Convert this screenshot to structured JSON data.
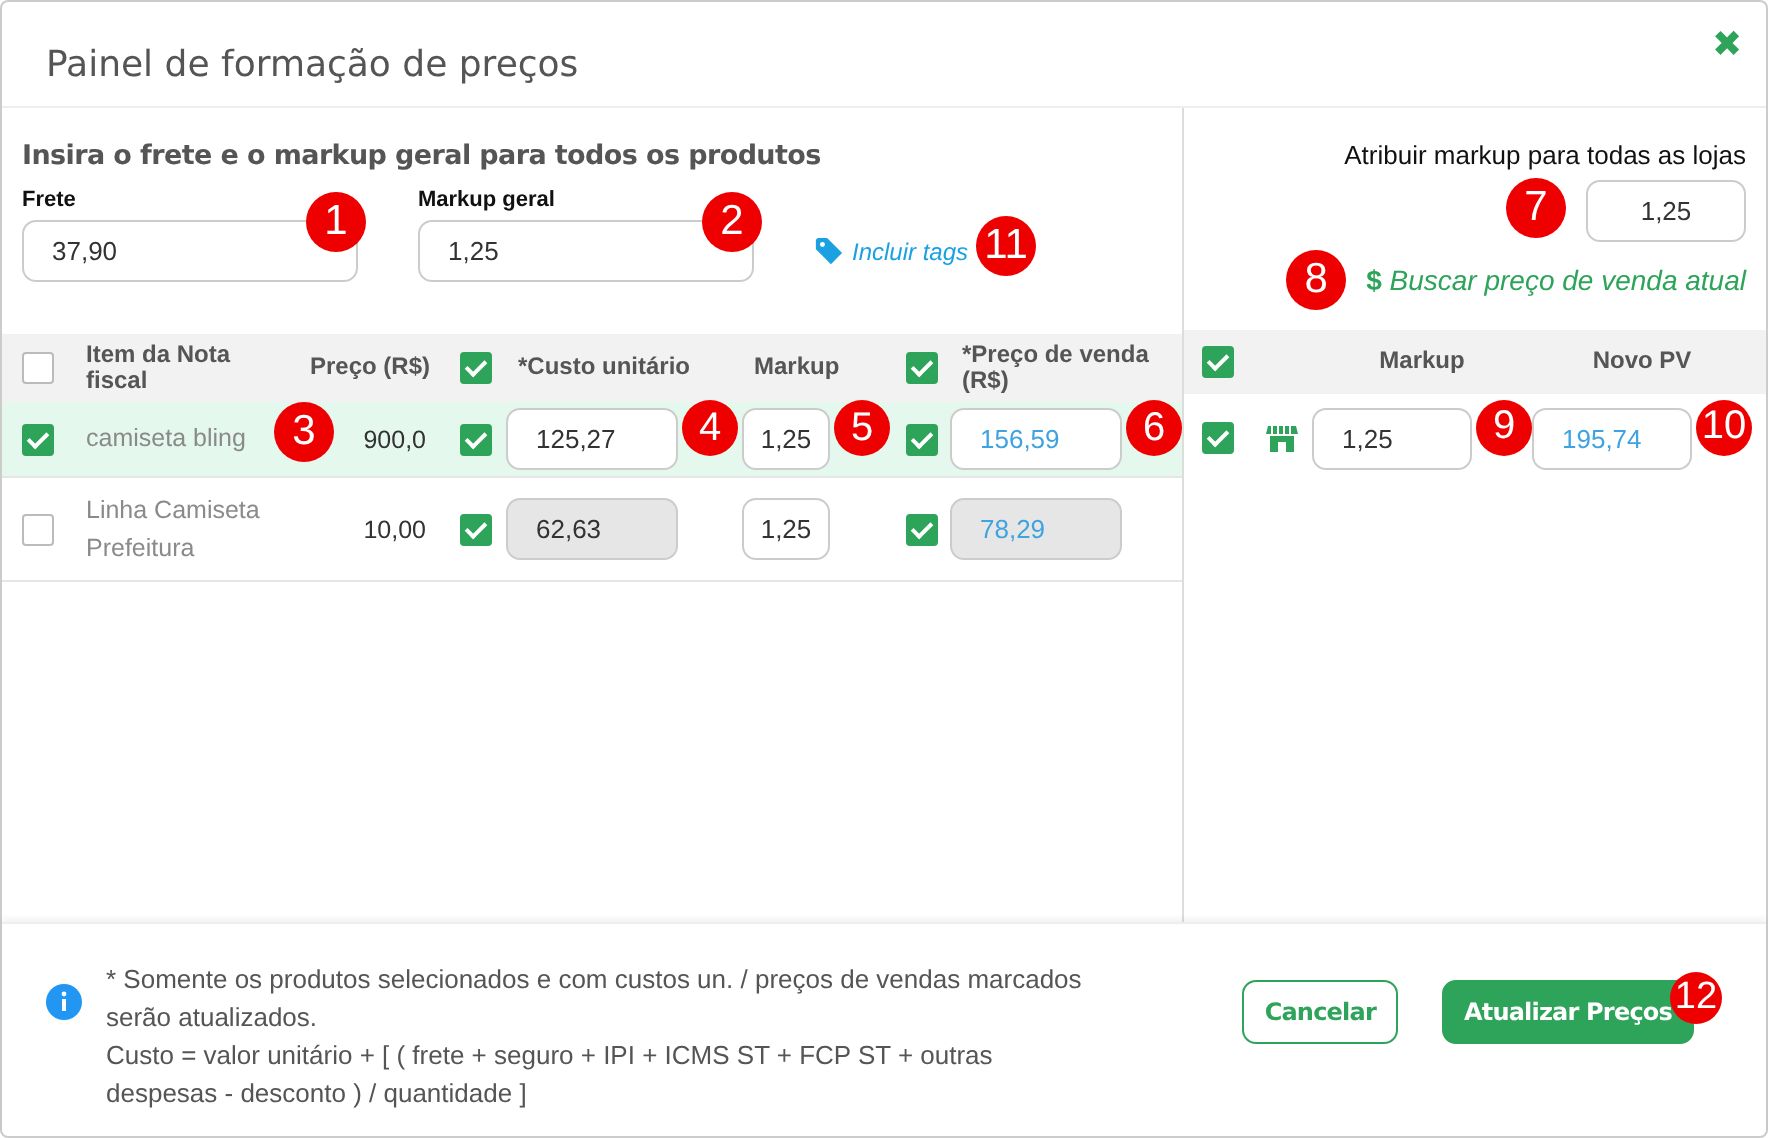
{
  "window": {
    "title": "Painel de formação de preços",
    "close_icon": "✖"
  },
  "general": {
    "heading": "Insira o frete e o markup geral para todos os produtos",
    "frete": {
      "label": "Frete",
      "value": "37,90",
      "badge": "1"
    },
    "markup": {
      "label": "Markup geral",
      "value": "1,25",
      "badge": "2"
    },
    "tags_link": {
      "label": "Incluir tags",
      "badge": "11"
    }
  },
  "table": {
    "select_all": false,
    "columns": [
      "Item da Nota fiscal",
      "Preço (R$)",
      "*Custo unitário",
      "Markup",
      "*Preço de venda (R$)"
    ],
    "cost_all_checked": true,
    "sale_all_checked": true,
    "rows": [
      {
        "selected": true,
        "item": "camiseta bling",
        "price": "900,0",
        "cost_checked": true,
        "cost": "125,27",
        "cost_disabled": false,
        "markup": "1,25",
        "sale_checked": true,
        "sale_price": "156,59",
        "sale_disabled": false,
        "badges": [
          "3",
          "4",
          "5",
          "6"
        ]
      },
      {
        "selected": false,
        "item": "Linha Camiseta Prefeitura",
        "price": "10,00",
        "cost_checked": true,
        "cost": "62,63",
        "cost_disabled": true,
        "markup": "1,25",
        "sale_checked": true,
        "sale_price": "78,29",
        "sale_disabled": true,
        "badges": []
      }
    ]
  },
  "stores": {
    "label": "Atribuir markup para todas as lojas",
    "value": "1,25",
    "value_badge": "7",
    "fetch_link": {
      "icon": "$",
      "label": "Buscar preço de venda atual",
      "badge": "8"
    },
    "all_checked": true,
    "columns": [
      "Markup",
      "Novo PV"
    ],
    "rows": [
      {
        "checked": true,
        "markup": "1,25",
        "new_pv": "195,74",
        "badges": [
          "9",
          "10"
        ]
      }
    ]
  },
  "footer": {
    "note": [
      "* Somente os produtos selecionados e com custos un. / preços de vendas marcados serão atualizados.",
      "Custo = valor unitário + [ ( frete + seguro + IPI + ICMS ST + FCP ST + outras despesas - desconto ) / quantidade ]"
    ],
    "buttons": [
      {
        "kind": "secondary",
        "label": "Cancelar"
      },
      {
        "kind": "primary",
        "label": "Atualizar Preços",
        "badge": "12"
      }
    ]
  }
}
